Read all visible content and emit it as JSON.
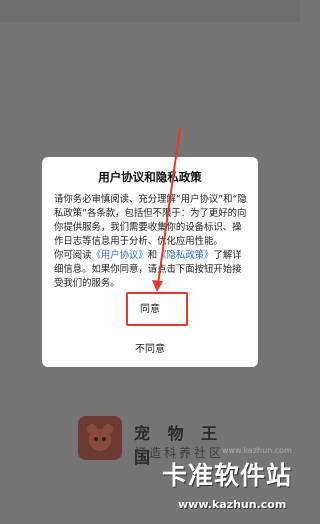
{
  "splash": {
    "app_name": "宠 物 王 国",
    "slogan": "打造科养社区"
  },
  "dialog": {
    "title": "用户协议和隐私政策",
    "para1": "请你务必审慎阅读、充分理解“用户协议”和“隐私政策”各条款，包括但不限于：为了更好的向你提供服务，我们需要收集你的设备标识、操作日志等信息用于分析、优化应用性能。",
    "para2_prefix": "你可阅读",
    "link_user_agreement": "《用户协议》",
    "para2_and": "和",
    "link_privacy": "《隐私政策》",
    "para2_suffix": "了解详细信息。如果你同意，请点击下面按钮开始接受我们的服务。",
    "agree_label": "同意",
    "disagree_label": "不同意"
  },
  "annotation": {
    "color": "#e23a2c"
  },
  "watermark": {
    "main": "卡准软件站",
    "faint": "www.kazhun.com",
    "url": "www.kazhun.com"
  }
}
